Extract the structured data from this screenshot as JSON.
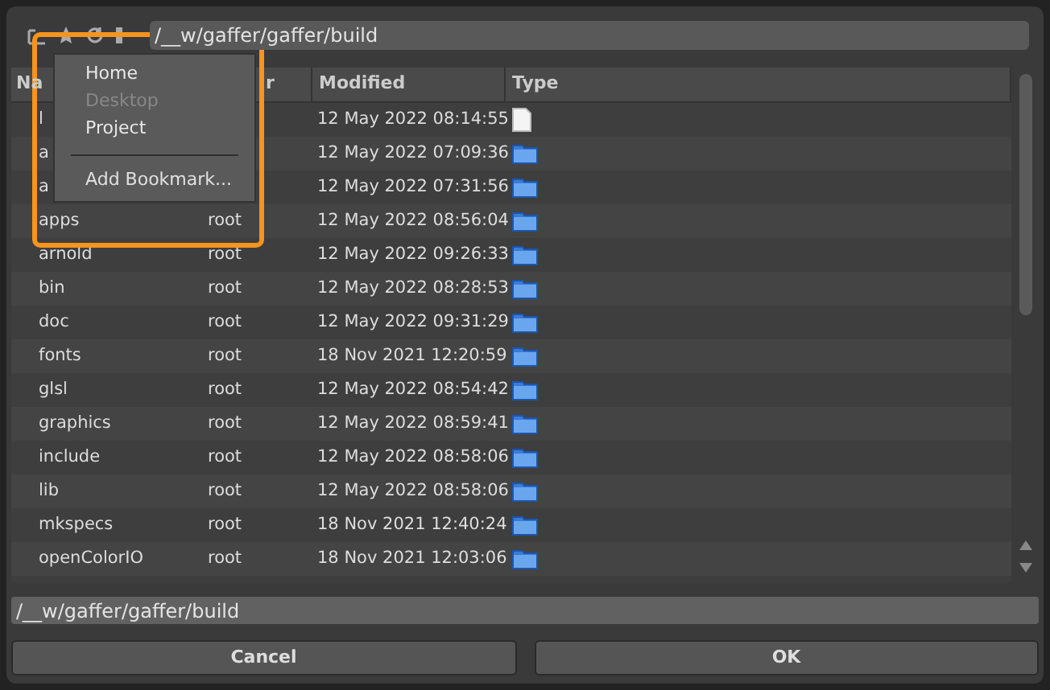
{
  "path_bar": {
    "value": "/__w/gaffer/gaffer/build"
  },
  "bookmarks_menu": {
    "items": [
      {
        "label": "Home",
        "disabled": false
      },
      {
        "label": "Desktop",
        "disabled": true
      },
      {
        "label": "Project",
        "disabled": false
      }
    ],
    "action": "Add Bookmark..."
  },
  "table": {
    "columns": [
      "Na",
      "r",
      "Modified",
      "Type"
    ],
    "rows": [
      {
        "name": "l",
        "owner": "",
        "modified": "12 May 2022 08:14:55",
        "kind": "file"
      },
      {
        "name": "a",
        "owner": "",
        "modified": "12 May 2022 07:09:36",
        "kind": "folder"
      },
      {
        "name": "a",
        "owner": "",
        "modified": "12 May 2022 07:31:56",
        "kind": "folder"
      },
      {
        "name": "apps",
        "owner": "root",
        "modified": "12 May 2022 08:56:04",
        "kind": "folder"
      },
      {
        "name": "arnold",
        "owner": "root",
        "modified": "12 May 2022 09:26:33",
        "kind": "folder"
      },
      {
        "name": "bin",
        "owner": "root",
        "modified": "12 May 2022 08:28:53",
        "kind": "folder"
      },
      {
        "name": "doc",
        "owner": "root",
        "modified": "12 May 2022 09:31:29",
        "kind": "folder"
      },
      {
        "name": "fonts",
        "owner": "root",
        "modified": "18 Nov 2021 12:20:59",
        "kind": "folder"
      },
      {
        "name": "glsl",
        "owner": "root",
        "modified": "12 May 2022 08:54:42",
        "kind": "folder"
      },
      {
        "name": "graphics",
        "owner": "root",
        "modified": "12 May 2022 08:59:41",
        "kind": "folder"
      },
      {
        "name": "include",
        "owner": "root",
        "modified": "12 May 2022 08:58:06",
        "kind": "folder"
      },
      {
        "name": "lib",
        "owner": "root",
        "modified": "12 May 2022 08:58:06",
        "kind": "folder"
      },
      {
        "name": "mkspecs",
        "owner": "root",
        "modified": "18 Nov 2021 12:40:24",
        "kind": "folder"
      },
      {
        "name": "openColorIO",
        "owner": "root",
        "modified": "18 Nov 2021 12:03:06",
        "kind": "folder"
      }
    ]
  },
  "file_field": {
    "value": "/__w/gaffer/gaffer/build"
  },
  "buttons": [
    "Cancel",
    "OK"
  ]
}
